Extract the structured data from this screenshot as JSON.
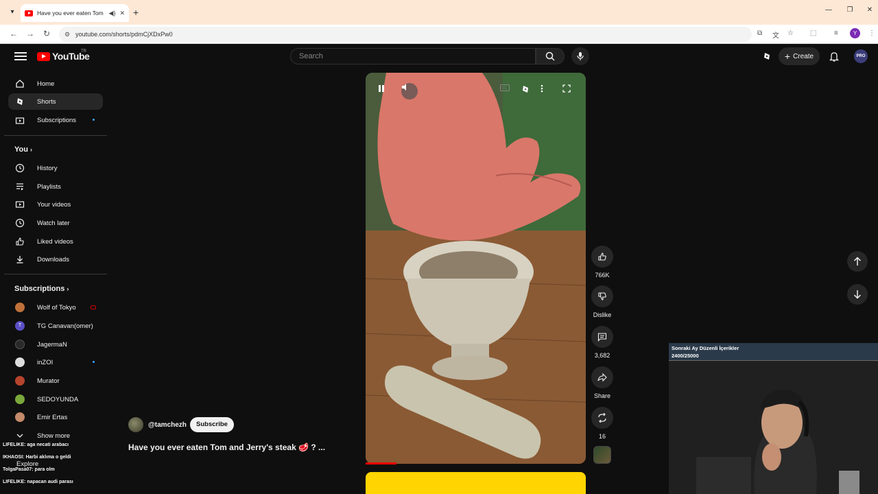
{
  "browser": {
    "tab_title": "Have you ever eaten Tom and Jerry's steak",
    "url": "youtube.com/shorts/pdmCjXDxPw0",
    "profile_initial": "Y"
  },
  "header": {
    "logo_text": "YouTube",
    "country_code": "TR",
    "search_placeholder": "Search",
    "create_label": "Create",
    "avatar_text": "PRO"
  },
  "sidebar": {
    "main": [
      {
        "label": "Home",
        "icon": "home-icon"
      },
      {
        "label": "Shorts",
        "icon": "shorts-icon"
      },
      {
        "label": "Subscriptions",
        "icon": "subscriptions-icon"
      }
    ],
    "you_heading": "You",
    "you_items": [
      {
        "label": "History",
        "icon": "history-icon"
      },
      {
        "label": "Playlists",
        "icon": "playlists-icon"
      },
      {
        "label": "Your videos",
        "icon": "your-videos-icon"
      },
      {
        "label": "Watch later",
        "icon": "watch-later-icon"
      },
      {
        "label": "Liked videos",
        "icon": "liked-videos-icon"
      },
      {
        "label": "Downloads",
        "icon": "downloads-icon"
      }
    ],
    "subs_heading": "Subscriptions",
    "subs": [
      {
        "label": "Wolf of Tokyo",
        "color": "#c0713a"
      },
      {
        "label": "TG Canavan(omer)",
        "color": "#5a4fc4",
        "initial": "T"
      },
      {
        "label": "JagermaN",
        "color": "#2a2a2a"
      },
      {
        "label": "inZOI",
        "color": "#dddddd"
      },
      {
        "label": "Murator",
        "color": "#b5442c"
      },
      {
        "label": "SEDOYUNDA",
        "color": "#7aa83a"
      },
      {
        "label": "Emir Ertas",
        "color": "#c48a6a"
      }
    ],
    "show_more": "Show more",
    "explore": "Explore"
  },
  "chat": [
    "LIFELIKE: aga necati arabacı",
    "IKHAOSI: Harbi aklıma o geldi",
    "TolgaPasa07: para olm",
    "LIFELIKE: napacan audi parası"
  ],
  "short": {
    "channel": "@tamchezh",
    "subscribe_label": "Subscribe",
    "title": "Have you ever eaten Tom and Jerry's steak 🥩 ? ...",
    "likes": "766K",
    "dislike_label": "Dislike",
    "comments": "3,682",
    "share_label": "Share",
    "remix": "16",
    "progress": 0.14
  },
  "stream_overlay": {
    "goal_title": "Sonraki Ay Düzenli İçerikler",
    "goal_count": "2400/25000"
  }
}
